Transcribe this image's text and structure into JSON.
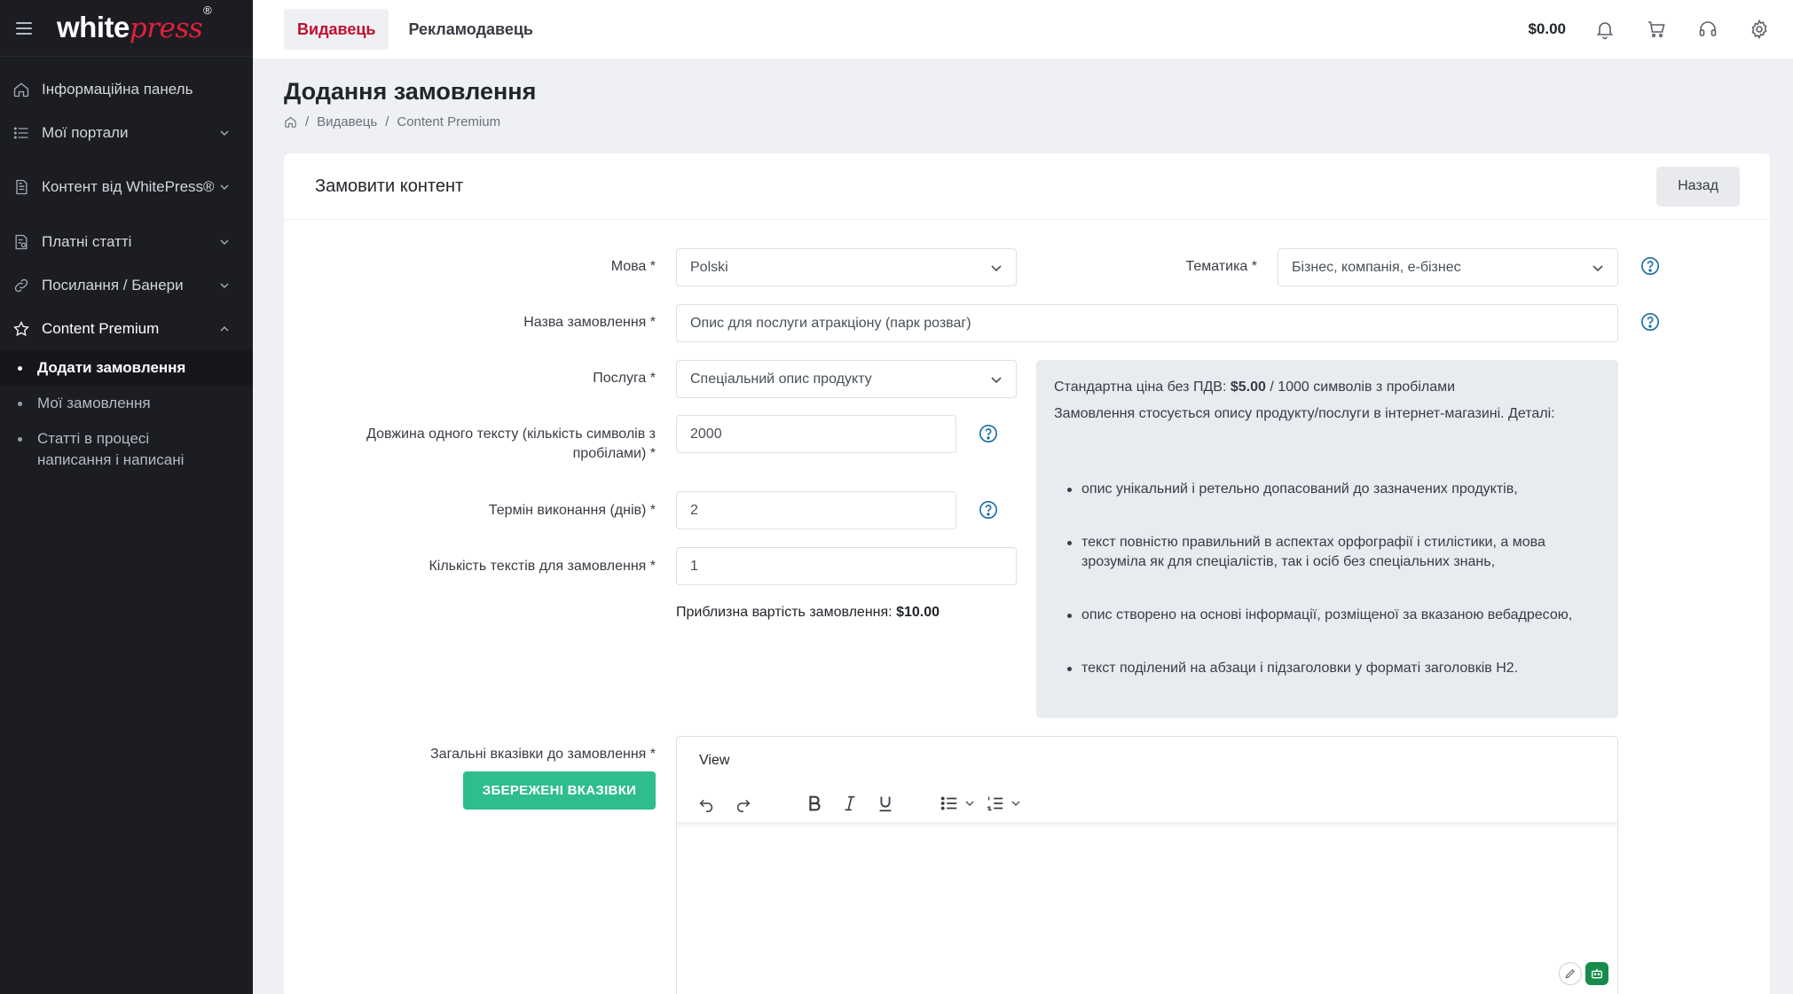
{
  "brand": {
    "logo_white": "white",
    "logo_press": "press",
    "logo_reg": "®"
  },
  "sidebar": {
    "items": [
      {
        "label": "Інформаційна панель",
        "icon": "home-icon"
      },
      {
        "label": "Мої портали",
        "icon": "list-icon"
      },
      {
        "label": "Контент від WhitePress®",
        "icon": "document-icon"
      },
      {
        "label": "Платні статті",
        "icon": "paid-article-icon"
      },
      {
        "label": "Посилання / Банери",
        "icon": "link-icon"
      },
      {
        "label": "Content Premium",
        "icon": "star-icon"
      }
    ],
    "subitems": [
      {
        "label": "Додати замовлення"
      },
      {
        "label": "Мої замовлення"
      },
      {
        "label": "Статті в процесі написання і написані"
      }
    ]
  },
  "topbar": {
    "tabs": [
      {
        "label": "Видавець"
      },
      {
        "label": "Рекламодавець"
      }
    ],
    "balance": "$0.00"
  },
  "page": {
    "title": "Додання замовлення",
    "breadcrumb": [
      "Видавець",
      "Content Premium"
    ]
  },
  "card": {
    "title": "Замовити контент",
    "back_label": "Назад"
  },
  "form": {
    "language_label": "Мова *",
    "language_value": "Polski",
    "topic_label": "Тематика *",
    "topic_value": "Бізнес, компанія, е-бізнес",
    "name_label": "Назва замовлення *",
    "name_value": "Опис для послуги атракціону (парк розваг)",
    "service_label": "Послуга *",
    "service_value": "Спеціальний опис продукту",
    "length_label": "Довжина одного тексту (кількість символів з пробілами) *",
    "length_value": "2000",
    "deadline_label": "Термін виконання (днів) *",
    "deadline_value": "2",
    "count_label": "Кількість текстів для замовлення *",
    "count_value": "1",
    "estimate_label": "Приблизна вартість замовлення:",
    "estimate_value": "$10.00",
    "instructions_label": "Загальні вказівки до замовлення *",
    "saved_button": "ЗБЕРЕЖЕНІ ВКАЗІВКИ"
  },
  "info": {
    "price_prefix": "Стандартна ціна без ПДВ:",
    "price_value": "$5.00",
    "price_suffix": "/ 1000 символів з пробілами",
    "description": "Замовлення стосується опису продукту/послуги в інтернет-магазині. Деталі:",
    "bullets": [
      "опис унікальний і ретельно допасований до зазначених продуктів,",
      "текст повністю правильний в аспектах орфографії і стилістики, а мова зрозуміла як для спеціалістів, так і осіб без спеціальних знань,",
      "опис створено на основі інформації, розміщеної за вказаною вебадресою,",
      "текст поділений на абзаци і підзаголовки у форматі заголовків H2."
    ]
  },
  "editor": {
    "menu_view": "View"
  },
  "colors": {
    "accent": "#c10f2f",
    "sidebar": "#1c1d22",
    "success": "#2ebd8f",
    "help": "#1d6fa5"
  }
}
